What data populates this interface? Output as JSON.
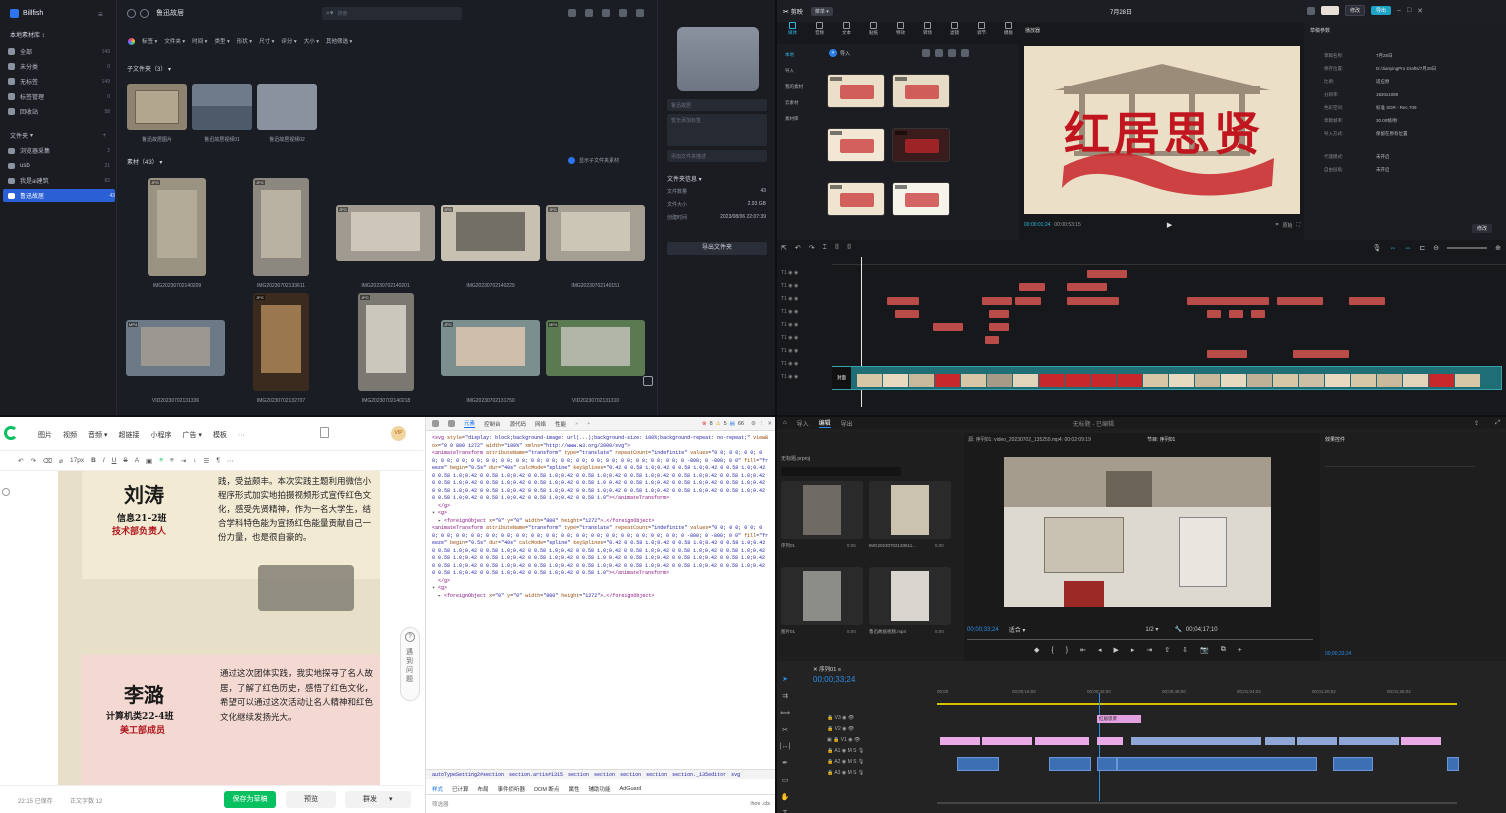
{
  "billfish": {
    "app_title": "Billfish",
    "library_name": "本地素材库",
    "sidebar": [
      {
        "label": "全部",
        "count": "149"
      },
      {
        "label": "未分类",
        "count": "0"
      },
      {
        "label": "无标签",
        "count": "149"
      },
      {
        "label": "标签管理",
        "count": "0"
      },
      {
        "label": "回收站",
        "count": "58"
      }
    ],
    "folders_header": "文件夹",
    "folders": [
      {
        "label": "浏览器采集",
        "count": "2"
      },
      {
        "label": "usb",
        "count": "21"
      },
      {
        "label": "我是ai建筑",
        "count": "82"
      },
      {
        "label": "鲁迅故居",
        "count": "43"
      }
    ],
    "breadcrumb": "鲁迅故居",
    "search_placeholder": "搜索",
    "filters": [
      "标签",
      "文件夹",
      "时间",
      "类型",
      "形状",
      "尺寸",
      "评分",
      "大小",
      "其他筛选"
    ],
    "subfolder_header": "子文件夹（3）",
    "subfolders": [
      "鲁迅故居图片",
      "鲁迅故居视频01",
      "鲁迅故居视频02"
    ],
    "assets_header": "素材（43）",
    "show_sub_label": "显示子文件夹素材",
    "assets_row1": [
      "IMG20230702140209",
      "IMG20230702133611",
      "IMG20230702140201",
      "IMG20230702140229",
      "IMG20230702140151"
    ],
    "assets_row2": [
      "VID20230702131336",
      "IMG20230702132707",
      "IMG20230702140218",
      "IMG20230702131750",
      "VID20230702131310"
    ],
    "right": {
      "folder_name": "鲁迅故居",
      "desc_placeholder": "暂无添加标签",
      "add_desc": "添加文件夹描述",
      "info_header": "文件夹信息",
      "rows": [
        {
          "k": "文件数量",
          "v": "43"
        },
        {
          "k": "文件大小",
          "v": "2.93 GB"
        },
        {
          "k": "创建时间",
          "v": "2023/08/06 22:07:39"
        }
      ],
      "export_btn": "导出文件夹"
    }
  },
  "capcut": {
    "logo": "剪映",
    "menu_btn": "菜单",
    "project_title": "7月28日",
    "toolbar": [
      "媒体",
      "音频",
      "文本",
      "贴纸",
      "特效",
      "转场",
      "滤镜",
      "调节",
      "模板"
    ],
    "left_nav": [
      "本地",
      "导入",
      "我的素材",
      "云素材",
      "素材库"
    ],
    "import_btn": "导入",
    "player_label": "播放器",
    "preview_title": "红居思贤",
    "timecode_current": "00:00:01:24",
    "timecode_total": "00:00:53:15",
    "ratio_btn": "原始",
    "props_header": "草稿参数",
    "props": [
      {
        "k": "草稿名称:",
        "v": "7月28日"
      },
      {
        "k": "保存位置:",
        "v": "D:/JianyingPro Drafts/7月28日"
      },
      {
        "k": "比例:",
        "v": "适应原"
      },
      {
        "k": "分辨率:",
        "v": "1920x1080"
      },
      {
        "k": "色彩空间:",
        "v": "标准 SDR - Rec.709"
      },
      {
        "k": "草稿帧率:",
        "v": "30.00帧/秒"
      },
      {
        "k": "导入方式:",
        "v": "保留在原有位置"
      },
      {
        "k": "代理模式:",
        "v": "未开启"
      },
      {
        "k": "自由层级:",
        "v": "未开启"
      }
    ],
    "props_edit_btn": "修改",
    "export_btn": "导出",
    "main_track_label": "封面"
  },
  "wechat": {
    "toolbar": [
      "图片",
      "视频",
      "音频",
      "超链接",
      "小程序",
      "广告",
      "模板"
    ],
    "font_size": "17px",
    "card1": {
      "name": "刘涛",
      "cls": "信息21-2班",
      "role": "技术部负责人",
      "text": "践，受益颇丰。本次实践主题利用微信小程序形式加实地拍摄视频形式宣传红色文化，感受先贤精神，作为一名大学生，结合学科特色能为宣扬红色能量贡献自己一份力量，也是很自豪的。"
    },
    "card2": {
      "name": "李潞",
      "cls": "计算机类22-4班",
      "role": "美工部成员",
      "text": "通过这次团体实践，我实地探寻了名人故居，了解了红色历史，感悟了红色文化，希望可以通过这次活动让名人精神和红色文化继续发扬光大。"
    },
    "side_help": "遇到问题",
    "status": "22:15 已保存",
    "word_count": "正文字数 12",
    "save_btn": "保存为草稿",
    "preview_btn": "预览",
    "publish_btn": "群发"
  },
  "devtools": {
    "tabs": [
      "元素",
      "控制台",
      "源代码",
      "网络",
      "性能"
    ],
    "errors": "8",
    "warnings": "5",
    "info": "66",
    "crumbs": [
      "autoTypeSetting2#section",
      "section.artis#1315",
      "section",
      "section",
      "section",
      "section",
      "section._135editor",
      "svg"
    ],
    "lower_tabs": [
      "样式",
      "已计算",
      "布局",
      "事件侦听器",
      "DOM 断点",
      "属性",
      "辅助功能",
      "AdGuard"
    ],
    "filter_placeholder": "筛选器",
    "pseudo": ":hov .cls"
  },
  "premiere": {
    "tabs": [
      "导入",
      "编辑",
      "导出"
    ],
    "title": "无标题 - 已编辑",
    "source_label": "源: 序列01: video_20230702_135250.mp4: 00:02:09:19",
    "program_label": "节目: 序列01",
    "effects_label": "效果控件",
    "source_time": "00;00;33;24",
    "fit": "适合",
    "ratio": "1/2",
    "duration": "00;04;17;10",
    "sequence_tab": "序列01",
    "seq_time": "00;00;33;24",
    "ruler": [
      "00;00",
      "00;00;16;00",
      "00;00;32;00",
      "00;00;48;00",
      "00;01;04;02",
      "00;01;20;02",
      "00;01;36;02"
    ],
    "project_name": "无标题.prproj",
    "bins": [
      {
        "name": "序列01",
        "dur": "9;06"
      },
      {
        "name": "IMG20230702133611...",
        "dur": "5;00"
      },
      {
        "name": "图片01",
        "dur": "5;00"
      },
      {
        "name": "鲁迅故居视频.mp4",
        "dur": "5;00"
      }
    ],
    "title_clip": "红居思贤"
  }
}
